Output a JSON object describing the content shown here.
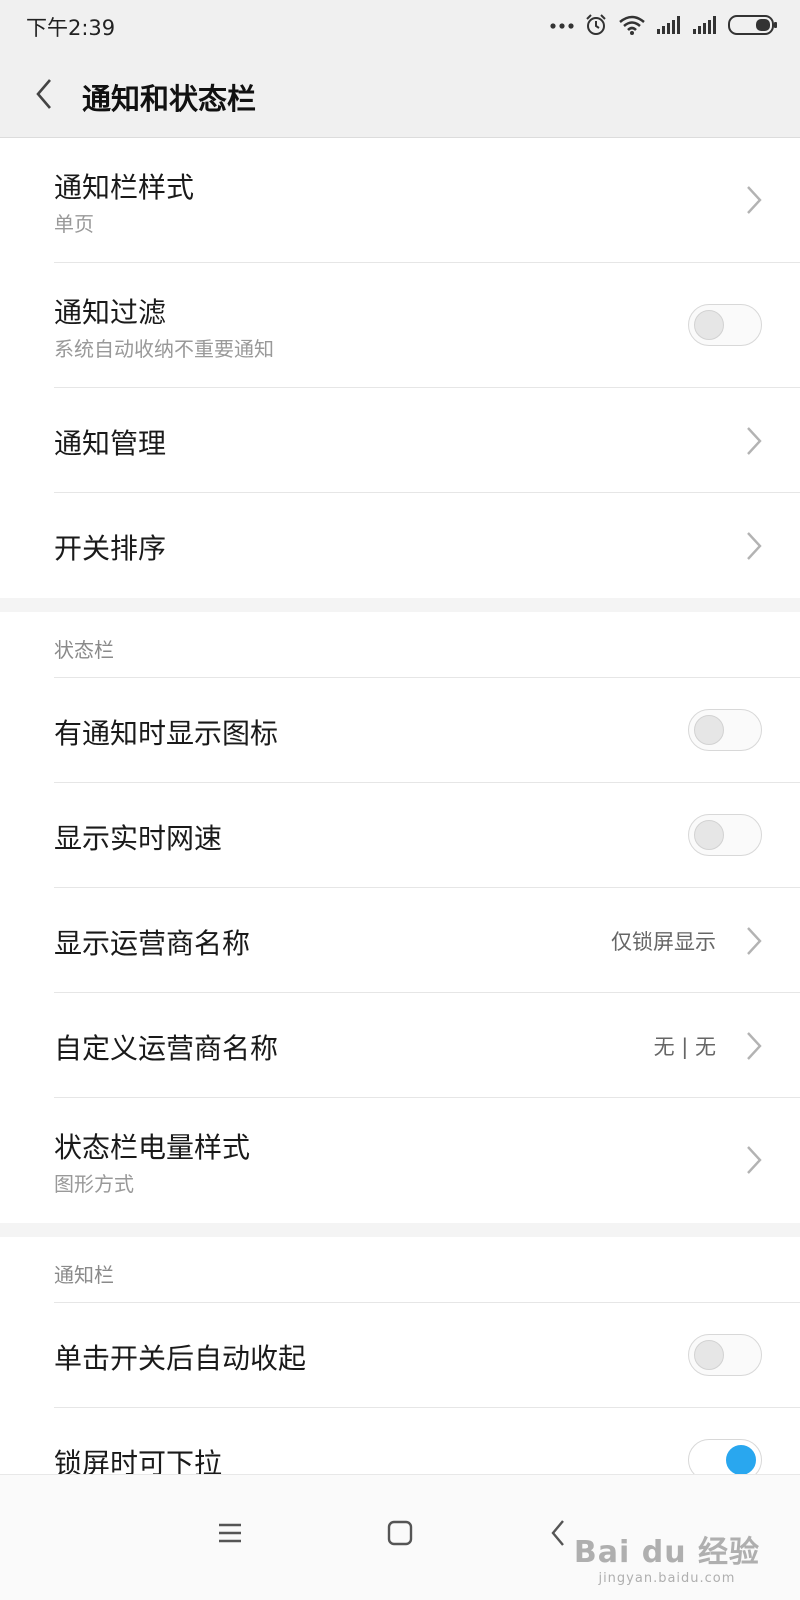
{
  "status_bar": {
    "time": "下午2:39",
    "icons": [
      "more-dots-icon",
      "alarm-icon",
      "wifi-icon",
      "signal-1-icon",
      "signal-2-icon",
      "battery-icon"
    ]
  },
  "app_bar": {
    "back_icon": "chevron-left-icon",
    "title": "通知和状态栏"
  },
  "sections": {
    "notifications": {
      "items": [
        {
          "title": "通知栏样式",
          "subtitle": "单页",
          "control": "chevron"
        },
        {
          "title": "通知过滤",
          "subtitle": "系统自动收纳不重要通知",
          "control": "toggle",
          "on": false
        },
        {
          "title": "通知管理",
          "control": "chevron"
        },
        {
          "title": "开关排序",
          "control": "chevron"
        }
      ]
    },
    "status_bar_section": {
      "header": "状态栏",
      "items": [
        {
          "title": "有通知时显示图标",
          "control": "toggle",
          "on": false
        },
        {
          "title": "显示实时网速",
          "control": "toggle",
          "on": false
        },
        {
          "title": "显示运营商名称",
          "value": "仅锁屏显示",
          "control": "chevron"
        },
        {
          "title": "自定义运营商名称",
          "value": "无 | 无",
          "control": "chevron"
        },
        {
          "title": "状态栏电量样式",
          "subtitle": "图形方式",
          "control": "chevron"
        }
      ]
    },
    "notification_bar_section": {
      "header": "通知栏",
      "items": [
        {
          "title": "单击开关后自动收起",
          "control": "toggle",
          "on": false
        },
        {
          "title": "锁屏时可下拉",
          "control": "toggle",
          "on": true
        }
      ]
    }
  },
  "nav_bar": {
    "buttons": [
      "menu-icon",
      "home-icon",
      "back-icon"
    ]
  },
  "watermark": {
    "main": "Bai du 经验",
    "sub": "jingyan.baidu.com"
  },
  "colors": {
    "accent": "#29a7ef",
    "header_bg": "#f0f0f0",
    "divider": "#e6e6e6",
    "section_gap": "#f4f4f4"
  }
}
